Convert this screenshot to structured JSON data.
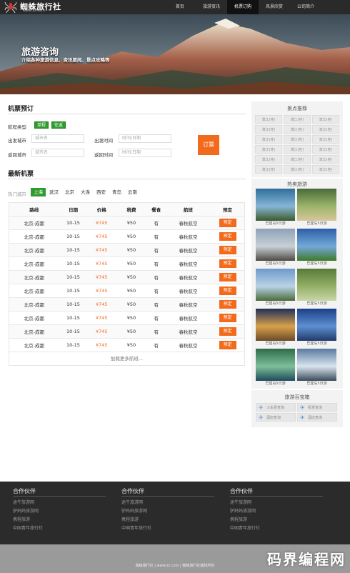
{
  "header": {
    "site_name": "蜘蛛旅行社",
    "site_url": "www.zz.com",
    "nav": [
      {
        "label": "首页",
        "active": false
      },
      {
        "label": "旅游资讯",
        "active": false
      },
      {
        "label": "机票订购",
        "active": true
      },
      {
        "label": "风景欣赏",
        "active": false
      },
      {
        "label": "公司简介",
        "active": false
      }
    ]
  },
  "banner": {
    "title": "旅游咨询",
    "subtitle": "介绍各种旅游信息、资讯要闻、景点攻略等"
  },
  "booking": {
    "title": "机票预订",
    "type_label": "航程类型",
    "type_oneway": "单程",
    "type_return": "往返",
    "from_city_label": "出发城市",
    "from_city_placeholder": "城市名",
    "depart_time_label": "出发时间",
    "depart_time_placeholder": "时间/日期",
    "return_city_label": "返回城市",
    "return_city_placeholder": "城市名",
    "return_time_label": "返回时间",
    "return_time_placeholder": "时间/日期",
    "submit_label": "订票"
  },
  "latest": {
    "title": "最新机票",
    "hot_city_label": "热门城市",
    "cities": [
      {
        "name": "上海",
        "active": true
      },
      {
        "name": "武汉",
        "active": false
      },
      {
        "name": "北京",
        "active": false
      },
      {
        "name": "大连",
        "active": false
      },
      {
        "name": "西安",
        "active": false
      },
      {
        "name": "青岛",
        "active": false
      },
      {
        "name": "云南",
        "active": false
      }
    ],
    "columns": [
      "路线",
      "日期",
      "价格",
      "税费",
      "餐食",
      "航班",
      "预定"
    ],
    "rows": [
      {
        "route": "北京-成都",
        "date": "10-15",
        "price": "¥745",
        "tax": "¥50",
        "meal": "有",
        "flight": "春秋航空",
        "action": "预定"
      },
      {
        "route": "北京-成都",
        "date": "10-15",
        "price": "¥745",
        "tax": "¥50",
        "meal": "有",
        "flight": "春秋航空",
        "action": "预定"
      },
      {
        "route": "北京-成都",
        "date": "10-15",
        "price": "¥745",
        "tax": "¥50",
        "meal": "有",
        "flight": "春秋航空",
        "action": "预定"
      },
      {
        "route": "北京-成都",
        "date": "10-15",
        "price": "¥745",
        "tax": "¥50",
        "meal": "有",
        "flight": "春秋航空",
        "action": "预定"
      },
      {
        "route": "北京-成都",
        "date": "10-15",
        "price": "¥745",
        "tax": "¥50",
        "meal": "有",
        "flight": "春秋航空",
        "action": "预定"
      },
      {
        "route": "北京-成都",
        "date": "10-15",
        "price": "¥745",
        "tax": "¥50",
        "meal": "有",
        "flight": "春秋航空",
        "action": "预定"
      },
      {
        "route": "北京-成都",
        "date": "10-15",
        "price": "¥745",
        "tax": "¥50",
        "meal": "有",
        "flight": "春秋航空",
        "action": "预定"
      },
      {
        "route": "北京-成都",
        "date": "10-15",
        "price": "¥745",
        "tax": "¥50",
        "meal": "有",
        "flight": "春秋航空",
        "action": "预定"
      },
      {
        "route": "北京-成都",
        "date": "10-15",
        "price": "¥745",
        "tax": "¥50",
        "meal": "有",
        "flight": "春秋航空",
        "action": "预定"
      },
      {
        "route": "北京-成都",
        "date": "10-15",
        "price": "¥745",
        "tax": "¥50",
        "meal": "有",
        "flight": "春秋航空",
        "action": "预定"
      }
    ],
    "load_more": "加载更多航班..."
  },
  "sidebar": {
    "spots_title": "景点推荐",
    "spots": [
      "漓江(桂)",
      "漓江(桂)",
      "漓江(桂)",
      "漓江(桂)",
      "漓江(桂)",
      "漓江(桂)",
      "漓江(桂)",
      "漓江(桂)",
      "漓江(桂)",
      "漓江(桂)",
      "漓江(桂)",
      "漓江(桂)",
      "漓江(桂)",
      "漓江(桂)",
      "漓江(桂)",
      "漓江(桂)",
      "漓江(桂)",
      "漓江(桂)"
    ],
    "hot_title": "热卖旅游",
    "hot_items": [
      {
        "caption": "巴厘岛5日游",
        "colors": [
          "#2f6f9a",
          "#86b6d6",
          "#3c5a2c"
        ]
      },
      {
        "caption": "巴厘岛5日游",
        "colors": [
          "#4a6b3a",
          "#9bb56a",
          "#d8c59a"
        ]
      },
      {
        "caption": "巴厘岛5日游",
        "colors": [
          "#8ea2b8",
          "#c9d0d6",
          "#4e4a44"
        ]
      },
      {
        "caption": "巴厘岛5日游",
        "colors": [
          "#2d5fa8",
          "#74a8d8",
          "#3f7a2a"
        ]
      },
      {
        "caption": "巴厘岛5日游",
        "colors": [
          "#6f9ac9",
          "#b9d2e6",
          "#4b6b3a"
        ]
      },
      {
        "caption": "巴厘岛5日游",
        "colors": [
          "#5a7a3a",
          "#93b066",
          "#c9d6a8"
        ]
      },
      {
        "caption": "巴厘岛5日游",
        "colors": [
          "#1f2f5a",
          "#d9a24a",
          "#6a4a2a"
        ]
      },
      {
        "caption": "巴厘岛5日游",
        "colors": [
          "#1d3f8a",
          "#5d8fd0",
          "#223a6a"
        ]
      },
      {
        "caption": "巴厘岛5日游",
        "colors": [
          "#2d6b4a",
          "#7fbf9a",
          "#1e4a5a"
        ]
      },
      {
        "caption": "巴厘岛5日游",
        "colors": [
          "#5a7aa0",
          "#d9e4ee",
          "#3a4a5a"
        ]
      }
    ],
    "tools_title": "旅游百宝箱",
    "tools": [
      "火车票查询",
      "机票查询",
      "酒店查询",
      "酒店查询"
    ]
  },
  "footer": {
    "columns": [
      {
        "title": "合作伙伴",
        "links": [
          "途牛旅游网",
          "驴妈妈旅游网",
          "携程旅游",
          "中国青年旅行社"
        ]
      },
      {
        "title": "合作伙伴",
        "links": [
          "途牛旅游网",
          "驴妈妈旅游网",
          "携程旅游",
          "中国青年旅行社"
        ]
      },
      {
        "title": "合作伙伴",
        "links": [
          "途牛旅游网",
          "驴妈妈旅游网",
          "携程旅游",
          "中国青年旅行社"
        ]
      }
    ],
    "copyright": "蜘蛛旅行社 | www.zz.com | 蜘蛛旅行社版权所有",
    "watermark": "码界编程网"
  },
  "colors": {
    "accent_orange": "#f26b1d",
    "accent_green": "#2d9b2d",
    "nav_bg": "#2a2a2a",
    "footer_bg": "#2b2b2b"
  }
}
